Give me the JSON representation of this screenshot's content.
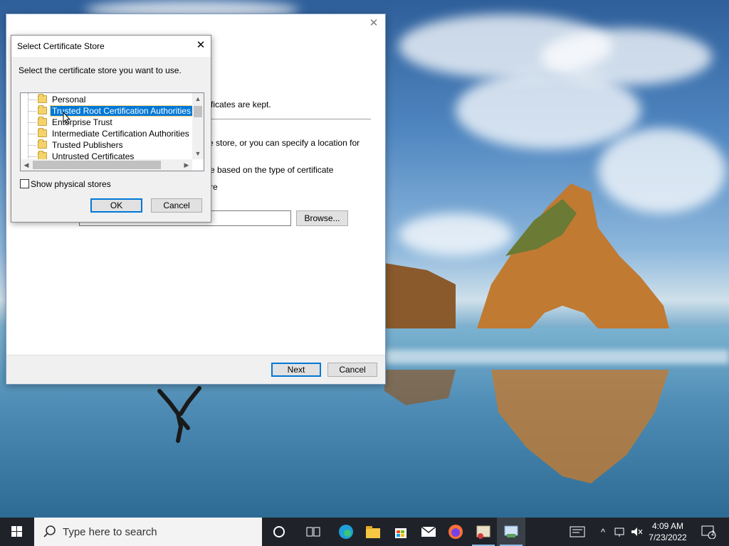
{
  "wizard": {
    "close_glyph": "✕",
    "line1": "tificates are kept.",
    "line2": "e store, or you can specify a location for",
    "line3": "e based on the type of certificate",
    "line4": "re",
    "browse_label": "Browse...",
    "next_label": "Next",
    "cancel_label": "Cancel"
  },
  "dialog": {
    "title": "Select Certificate Store",
    "close_glyph": "✕",
    "prompt": "Select the certificate store you want to use.",
    "stores": [
      {
        "label": "Personal",
        "selected": false
      },
      {
        "label": "Trusted Root Certification Authorities",
        "selected": true
      },
      {
        "label": "Enterprise Trust",
        "selected": false
      },
      {
        "label": "Intermediate Certification Authorities",
        "selected": false
      },
      {
        "label": "Trusted Publishers",
        "selected": false
      },
      {
        "label": "Untrusted Certificates",
        "selected": false
      }
    ],
    "show_physical_label": "Show physical stores",
    "show_physical_checked": false,
    "ok_label": "OK",
    "cancel_label": "Cancel"
  },
  "taskbar": {
    "search_placeholder": "Type here to search",
    "icons": [
      "cortana-icon",
      "task-view-icon",
      "edge-icon",
      "file-explorer-icon",
      "store-icon",
      "mail-icon",
      "firefox-icon",
      "certificate-manager-icon",
      "certificate-import-wizard-icon"
    ],
    "time": "4:09 AM",
    "date": "7/23/2022",
    "notification_count": "2"
  },
  "colors": {
    "accent": "#0078d7",
    "taskbar": "#1f2329"
  }
}
